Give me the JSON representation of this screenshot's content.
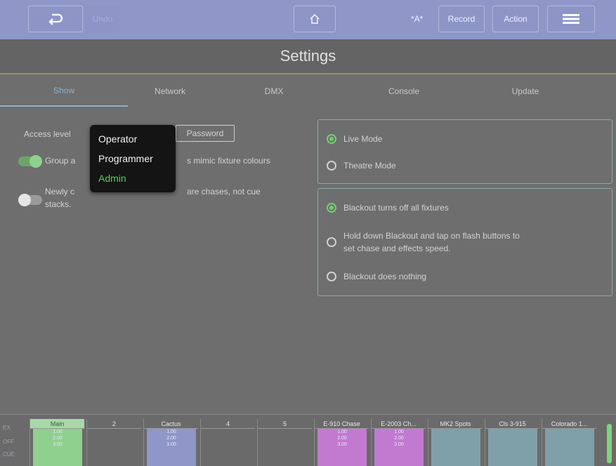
{
  "toolbar": {
    "back_icon": "undo-arrow-icon",
    "undo_label": "Undo",
    "home_icon": "home-icon",
    "highlight_label": "*A*",
    "record_label": "Record",
    "action_label": "Action",
    "menu_icon": "hamburger-menu-icon"
  },
  "page": {
    "title": "Settings"
  },
  "tabs": [
    {
      "label": "Show",
      "active": true
    },
    {
      "label": "Network",
      "active": false
    },
    {
      "label": "DMX",
      "active": false
    },
    {
      "label": "Console",
      "active": false
    },
    {
      "label": "Update",
      "active": false
    }
  ],
  "show_settings": {
    "access_label": "Access level",
    "password_label": "Password",
    "group_label_start": "Group a",
    "group_label_end": "s mimic fixture colours",
    "group_toggle": true,
    "newly_label_line1a": "Newly c",
    "newly_label_line1b": "are chases, not cue",
    "newly_label_line2": "stacks.",
    "newly_toggle": false
  },
  "access_dropdown": {
    "options": [
      "Operator",
      "Programmer",
      "Admin"
    ],
    "selected": "Admin"
  },
  "mode_panel": {
    "options": [
      "Live Mode",
      "Theatre Mode"
    ],
    "selected": "Live Mode"
  },
  "blackout_panel": {
    "options": [
      "Blackout turns off all fixtures",
      "Hold down Blackout and tap on flash buttons to",
      "set chase and effects speed.",
      "Blackout does nothing"
    ],
    "selected": "Blackout turns off all fixtures"
  },
  "playback_bar": {
    "side_labels": [
      "EX",
      "OFF",
      "CUE"
    ],
    "columns": [
      {
        "label": "Main",
        "color": "#8fd08f",
        "values": [
          "1.00",
          "2.00",
          "3.00"
        ]
      },
      {
        "label": "2",
        "color": "",
        "values": []
      },
      {
        "label": "Cactus",
        "color": "#8f97c9",
        "values": [
          "1.00",
          "2.00",
          "3.00"
        ]
      },
      {
        "label": "4",
        "color": "",
        "values": []
      },
      {
        "label": "5",
        "color": "",
        "values": []
      },
      {
        "label": "E-910 Chase",
        "color": "#c27ad0",
        "values": [
          "1.00",
          "2.00",
          "3.00"
        ]
      },
      {
        "label": "E-2003 Ch...",
        "color": "#c27ad0",
        "values": [
          "1.00",
          "2.00",
          "3.00"
        ]
      },
      {
        "label": "MK2 Spots",
        "color": "#7fa0a8",
        "values": []
      },
      {
        "label": "Cls 3-915",
        "color": "#7fa0a8",
        "values": []
      },
      {
        "label": "Colorado 1...",
        "color": "#7fa0a8",
        "values": []
      }
    ]
  }
}
